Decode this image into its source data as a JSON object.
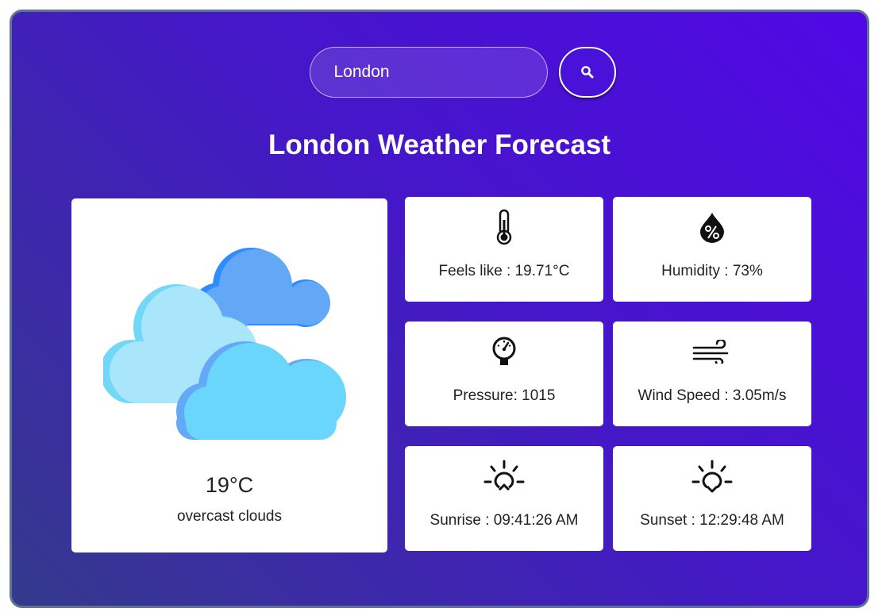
{
  "search": {
    "value": "London",
    "button_icon": "search-icon"
  },
  "title": "London Weather Forecast",
  "current": {
    "icon": "overcast-clouds-icon",
    "temperature": "19°C",
    "description": "overcast clouds"
  },
  "details": {
    "feels_like": {
      "icon": "thermometer-icon",
      "text": "Feels like : 19.71°C"
    },
    "humidity": {
      "icon": "humidity-drop-icon",
      "text": "Humidity : 73%"
    },
    "pressure": {
      "icon": "pressure-gauge-icon",
      "text": "Pressure: 1015"
    },
    "wind_speed": {
      "icon": "wind-icon",
      "text": "Wind Speed : 3.05m/s"
    },
    "sunrise": {
      "icon": "sunrise-icon",
      "text": "Sunrise : 09:41:26 AM"
    },
    "sunset": {
      "icon": "sunset-icon",
      "text": "Sunset : 12:29:48 AM"
    }
  },
  "colors": {
    "gradient_start": "#5108e6",
    "gradient_end": "#343a8c",
    "card_background": "#ffffff",
    "text_dark": "#222222"
  }
}
